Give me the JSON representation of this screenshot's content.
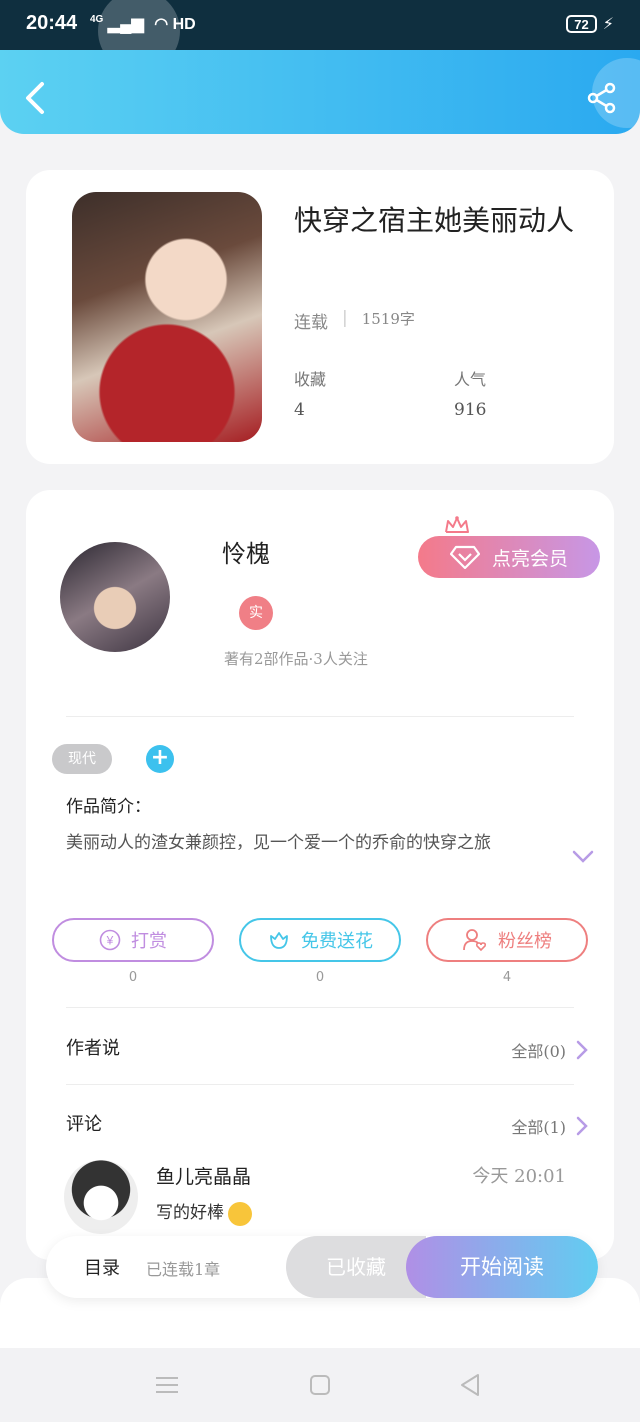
{
  "status_bar": {
    "time": "20:44",
    "network": "4G",
    "hd": "HD",
    "battery": "72"
  },
  "header": {
    "back_icon": "chevron-left-icon",
    "share_icon": "share-icon",
    "color": "#2aa9f0"
  },
  "book": {
    "title": "快穿之宿主她美丽动人",
    "status": "连载",
    "word_count": "1519字",
    "favorites_label": "收藏",
    "favorites_value": "4",
    "popularity_label": "人气",
    "popularity_value": "916"
  },
  "author": {
    "name": "怜槐",
    "badge": "实",
    "stats": "著有2部作品·3人关注",
    "vip_button": "点亮会员"
  },
  "tags": {
    "items": [
      "现代"
    ],
    "add_label": "+"
  },
  "intro": {
    "label": "作品简介：",
    "text": "美丽动人的渣女兼颜控，见一个爱一个的乔俞的快穿之旅"
  },
  "actions": [
    {
      "label": "打赏",
      "count": "0",
      "color": "#c08de0",
      "icon": "yen-icon"
    },
    {
      "label": "免费送花",
      "count": "0",
      "color": "#45c6e8",
      "icon": "flower-icon"
    },
    {
      "label": "粉丝榜",
      "count": "4",
      "color": "#ee7f7f",
      "icon": "fans-icon"
    }
  ],
  "author_says": {
    "title": "作者说",
    "link": "全部(0)"
  },
  "comments": {
    "title": "评论",
    "link": "全部(1)",
    "items": [
      {
        "user": "鱼儿亮晶晶",
        "time": "今天 20:01",
        "text": "写的好棒"
      }
    ]
  },
  "bottom_bar": {
    "toc_label": "目录",
    "toc_status": "已连载1章",
    "collected_label": "已收藏",
    "read_label": "开始阅读"
  },
  "nav": [
    "menu-icon",
    "home-icon",
    "back-triangle-icon"
  ]
}
